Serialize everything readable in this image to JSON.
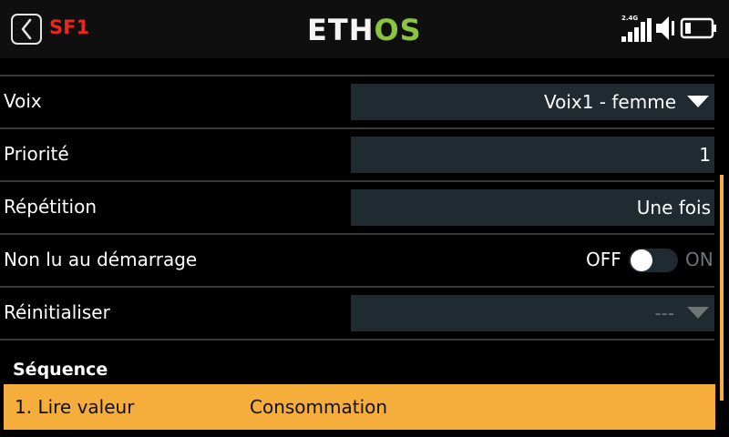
{
  "header": {
    "function_label": "SF1",
    "logo_part1": "ETH",
    "logo_part2": "OS",
    "radio_band": "2.4G",
    "icons": [
      "back-icon",
      "signal-bars-icon",
      "speaker-icon",
      "battery-icon"
    ],
    "colors": {
      "sf_label": "#e8281e",
      "logo_accent": "#8bc53f",
      "highlight": "#f5ad3b",
      "field_bg": "#1f2a31"
    }
  },
  "settings": [
    {
      "label": "Voix",
      "value": "Voix1 - femme"
    },
    {
      "label": "Priorité",
      "value": "1"
    },
    {
      "label": "Répétition",
      "value": "Une fois"
    },
    {
      "label": "Non lu au démarrage",
      "off_label": "OFF",
      "on_label": "ON",
      "state": "off"
    },
    {
      "label": "Réinitialiser",
      "value": "---"
    }
  ],
  "sequence": {
    "title": "Séquence",
    "items": [
      {
        "index": "1. Lire valeur",
        "value": "Consommation",
        "selected": true
      }
    ]
  }
}
